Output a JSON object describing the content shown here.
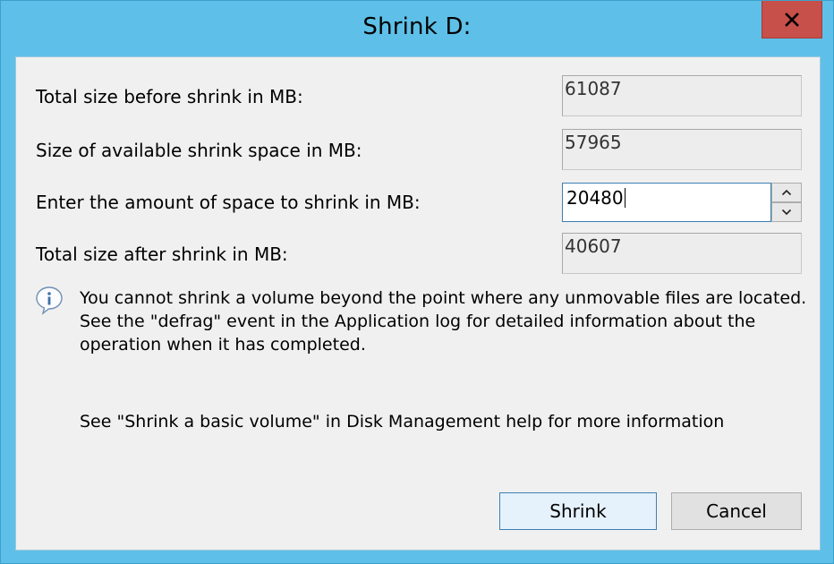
{
  "window": {
    "title": "Shrink D:",
    "close_icon": "close-icon"
  },
  "fields": {
    "total_size_label": "Total size before shrink in MB:",
    "total_size_value": "61087",
    "available_label": "Size of available shrink space in MB:",
    "available_value": "57965",
    "amount_label": "Enter the amount of space to shrink in MB:",
    "amount_value": "20480",
    "after_label": "Total size after shrink in MB:",
    "after_value": "40607"
  },
  "info": {
    "icon": "info-icon",
    "text": "You cannot shrink a volume beyond the point where any unmovable files are located. See the \"defrag\" event in the Application log for detailed information about the operation when it has completed."
  },
  "help": {
    "text": "See \"Shrink a basic volume\" in Disk Management help for more information"
  },
  "buttons": {
    "shrink_label": "Shrink",
    "cancel_label": "Cancel"
  },
  "colors": {
    "titlebar": "#5ec0e8",
    "close_button": "#c7504a",
    "client_background": "#f0f0f0",
    "focus_border": "#3c7fb1"
  }
}
